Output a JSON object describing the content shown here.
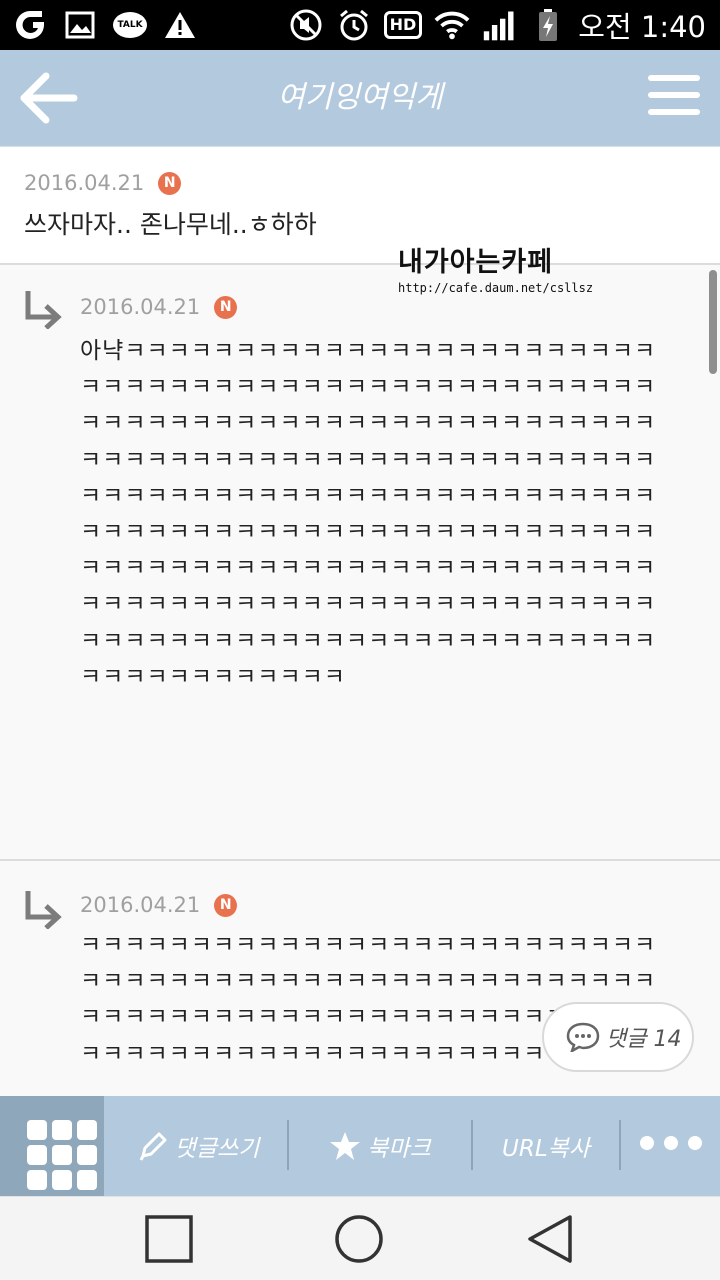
{
  "status_bar": {
    "talk_label": "TALK",
    "hd_label": "HD",
    "time": "오전 1:40"
  },
  "header": {
    "title": "여기잉여익게"
  },
  "comments": [
    {
      "date": "2016.04.21",
      "badge": "N",
      "text": "쓰자마자.. 존나무네..ㅎ하하"
    },
    {
      "date": "2016.04.21",
      "badge": "N",
      "text": "아냑ㅋㅋㅋㅋㅋㅋㅋㅋㅋㅋㅋㅋㅋㅋㅋㅋㅋㅋㅋㅋㅋㅋㅋㅋㅋㅋㅋㅋㅋㅋㅋㅋㅋㅋㅋㅋㅋㅋㅋㅋㅋㅋㅋㅋㅋㅋㅋㅋㅋㅋㅋㅋㅋㅋㅋㅋㅋㅋㅋㅋㅋㅋㅋㅋㅋㅋㅋㅋㅋㅋㅋㅋㅋㅋㅋㅋㅋㅋㅋㅋㅋㅋㅋㅋㅋㅋㅋㅋㅋㅋㅋㅋㅋㅋㅋㅋㅋㅋㅋㅋㅋㅋㅋㅋㅋㅋㅋㅋㅋㅋㅋㅋㅋㅋㅋㅋㅋㅋㅋㅋㅋㅋㅋㅋㅋㅋㅋㅋㅋㅋㅋㅋㅋㅋㅋㅋㅋㅋㅋㅋㅋㅋㅋㅋㅋㅋㅋㅋㅋㅋㅋㅋㅋㅋㅋㅋㅋㅋㅋㅋㅋㅋㅋㅋㅋㅋㅋㅋㅋㅋㅋㅋㅋㅋㅋㅋㅋㅋㅋㅋㅋㅋㅋㅋㅋㅋㅋㅋㅋㅋㅋㅋㅋㅋㅋㅋㅋㅋㅋㅋㅋㅋㅋㅋㅋㅋㅋㅋㅋㅋㅋㅋㅋㅋㅋㅋㅋㅋㅋㅋㅋㅋㅋㅋㅋㅋㅋㅋㅋㅋㅋㅋㅋㅋㅋㅋㅋㅋㅋㅋㅋㅋㅋㅋ"
    },
    {
      "date": "2016.04.21",
      "badge": "N",
      "text": "ㅋㅋㅋㅋㅋㅋㅋㅋㅋㅋㅋㅋㅋㅋㅋㅋㅋㅋㅋㅋㅋㅋㅋㅋㅋㅋㅋㅋㅋㅋㅋㅋㅋㅋㅋㅋㅋㅋㅋㅋㅋㅋㅋㅋㅋㅋㅋㅋㅋㅋㅋㅋㅋㅋㅋㅋㅋㅋㅋㅋㅋㅋㅋㅋㅋㅋㅋㅋㅋㅋㅋㅋㅋㅋㅋㅋㅋㅋㅋㅋㅋㅋㅋㅋㅋㅋㅋㅋㅋㅋㅋㅋㅋㅋㅋㅋㅋㅋㅋㅋㅋㅋㅋ"
    }
  ],
  "watermark": {
    "title": "내가아는카페",
    "url": "http://cafe.daum.net/csllsz"
  },
  "comment_count": {
    "label": "댓글 14"
  },
  "toolbar": {
    "write_label": "댓글쓰기",
    "bookmark_label": "북마크",
    "url_copy_label": "URL복사"
  },
  "icons": {
    "back": "arrow-left-icon",
    "menu": "hamburger-icon",
    "reply": "reply-arrow-icon",
    "pencil": "pencil-icon",
    "star": "star-icon",
    "chat": "chat-bubble-icon"
  },
  "colors": {
    "header_bg": "#b3c9de",
    "toolbar_bg": "#b3c9de",
    "grid_btn_bg": "#8fa7ba",
    "badge": "#e8714e"
  }
}
